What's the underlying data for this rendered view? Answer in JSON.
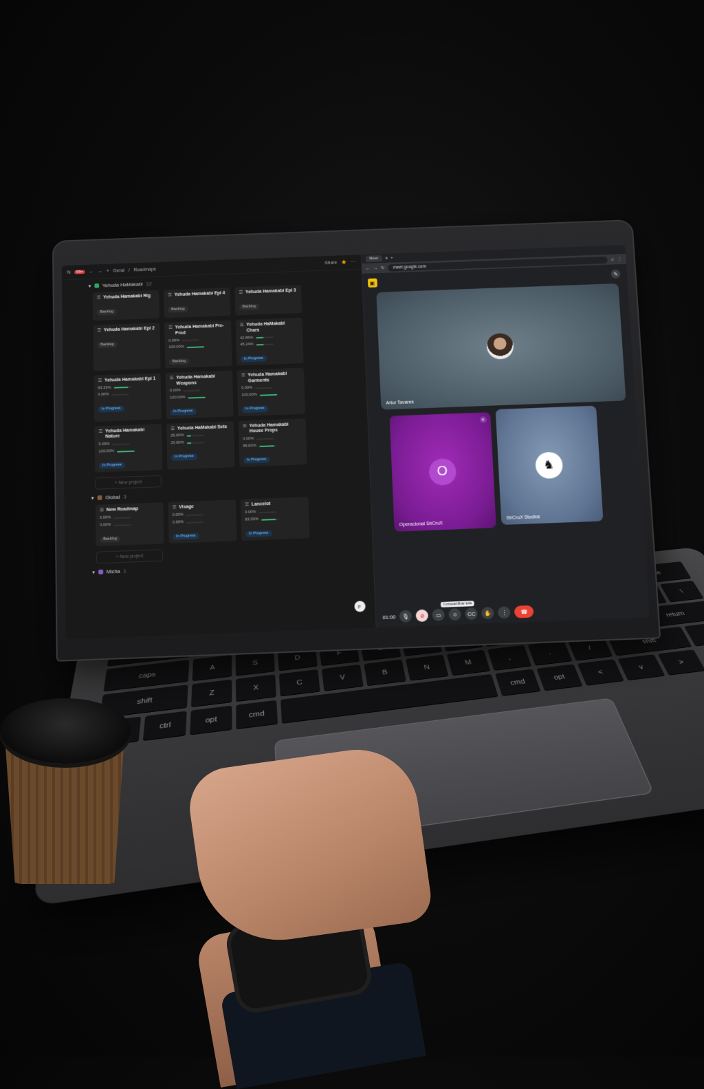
{
  "left_app": {
    "breadcrumb": [
      "Geral",
      "Roadmaps"
    ],
    "notification_count": "99+",
    "share_label": "Share",
    "groups": [
      {
        "name": "Yehuda HaMakabi",
        "count": "12",
        "color": "#2fa36b",
        "cards": [
          {
            "title": "Yehuda Hamakabi Rig",
            "status": "Backlog"
          },
          {
            "title": "Yehuda Hamakabi Epi 4",
            "status": "Backlog"
          },
          {
            "title": "Yehuda Hamakabi Epi 3",
            "status": "Backlog"
          },
          {
            "title": "Yehuda Hamakabi Epi 2",
            "status": "Backlog"
          },
          {
            "title": "Yehuda Hamakabi Pre-Prod",
            "p1": "0.00%",
            "p2": "100.00%",
            "status": "Backlog"
          },
          {
            "title": "Yehuda HaMakabi Chars",
            "p1": "42.86%",
            "p2": "45.24%",
            "status": "In Progress"
          },
          {
            "title": "Yehuda Hamakabi Epi 1",
            "p1": "83.33%",
            "p2": "0.00%",
            "status": "In Progress"
          },
          {
            "title": "Yehuda Hamakabi Weapons",
            "p1": "0.00%",
            "p2": "100.00%",
            "status": "In Progress"
          },
          {
            "title": "Yehuda Hamakabi Garments",
            "p1": "0.00%",
            "p2": "100.00%",
            "status": "In Progress"
          },
          {
            "title": "Yehuda Hamakabi Nature",
            "p1": "0.00%",
            "p2": "100.00%",
            "status": "In Progress"
          },
          {
            "title": "Yehuda HaMakabi Sets",
            "p1": "25.00%",
            "p2": "25.00%",
            "status": "In Progress"
          },
          {
            "title": "Yehuda Hamakabi House Props",
            "p1": "0.00%",
            "p2": "85.83%",
            "status": "In Progress"
          }
        ],
        "new_project": "+ New project"
      },
      {
        "name": "Global",
        "count": "3",
        "color": "#8a5a3a",
        "cards": [
          {
            "title": "New Roadmap",
            "p1": "0.00%",
            "p2": "0.00%",
            "status": "Backlog"
          },
          {
            "title": "Visage",
            "p1": "0.00%",
            "p2": "0.00%",
            "status": "In Progress"
          },
          {
            "title": "Lancelot",
            "p1": "0.00%",
            "p2": "83.33%",
            "status": "In Progress"
          }
        ],
        "new_project": "+ New project"
      },
      {
        "name": "Micha",
        "count": "1",
        "color": "#8b5cc6",
        "cards": []
      }
    ],
    "avatar_letter": "F"
  },
  "right_app": {
    "tab_title": "Meet",
    "url": "meet.google.com",
    "participants": [
      {
        "name": "Artur Tavares"
      },
      {
        "name": "Operacional SirCruX",
        "initial": "O"
      },
      {
        "name": "SirCruX Studios"
      }
    ],
    "time": "01:00",
    "tooltip": "Compartilhar tela"
  }
}
